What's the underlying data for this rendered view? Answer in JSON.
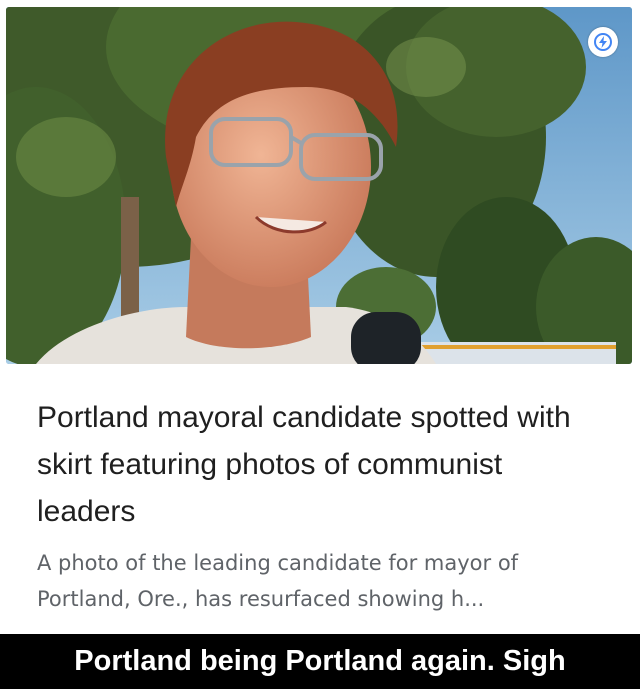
{
  "article": {
    "headline": "Portland mayoral candidate spotted with skirt featuring photos of communist leaders",
    "snippet": "A photo of the leading candidate for mayor of Portland, Ore., has resurfaced showing h..."
  },
  "caption": {
    "text": "Portland being Portland again. Sigh"
  },
  "icons": {
    "amp_badge": "lightning-bolt-icon"
  },
  "colors": {
    "headline": "#1f1f1f",
    "snippet": "#5f6368",
    "caption_background": "#000000",
    "caption_text": "#ffffff",
    "amp_bolt": "#4285f4"
  }
}
